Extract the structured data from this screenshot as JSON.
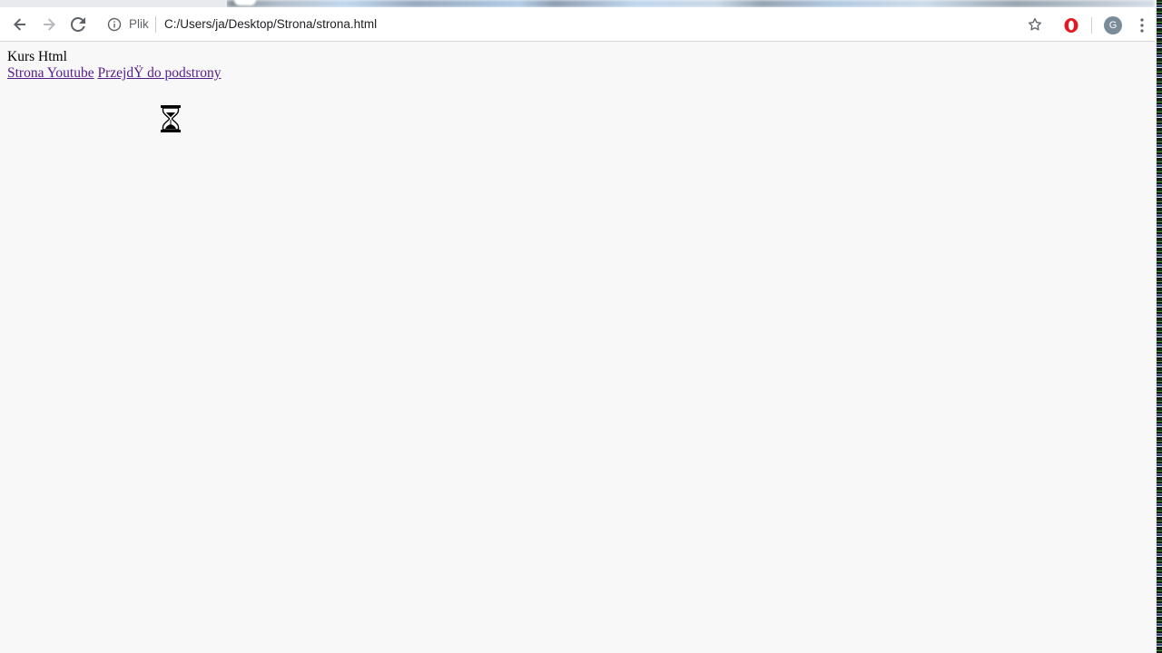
{
  "browser": {
    "scheme_label": "Plik",
    "url": "C:/Users/ja/Desktop/Strona/strona.html",
    "profile_initial": "G",
    "icons": {
      "back": "arrow-left-icon",
      "forward": "arrow-right-icon",
      "reload": "reload-icon",
      "info": "info-icon",
      "bookmark": "star-icon",
      "extension": "opera-icon",
      "menu": "kebab-menu-icon"
    },
    "colors": {
      "toolbar_bg": "#ffffff",
      "opera_red": "#e5181f",
      "avatar_bg": "#7a8c99"
    }
  },
  "page": {
    "heading": "Kurs Html",
    "links": [
      {
        "text": "Strona Youtube"
      },
      {
        "text": "PrzejdŸ do podstrony"
      }
    ],
    "cursor": "hourglass-icon",
    "colors": {
      "background": "#f8f8f8",
      "visited_link": "#551a8b"
    }
  }
}
